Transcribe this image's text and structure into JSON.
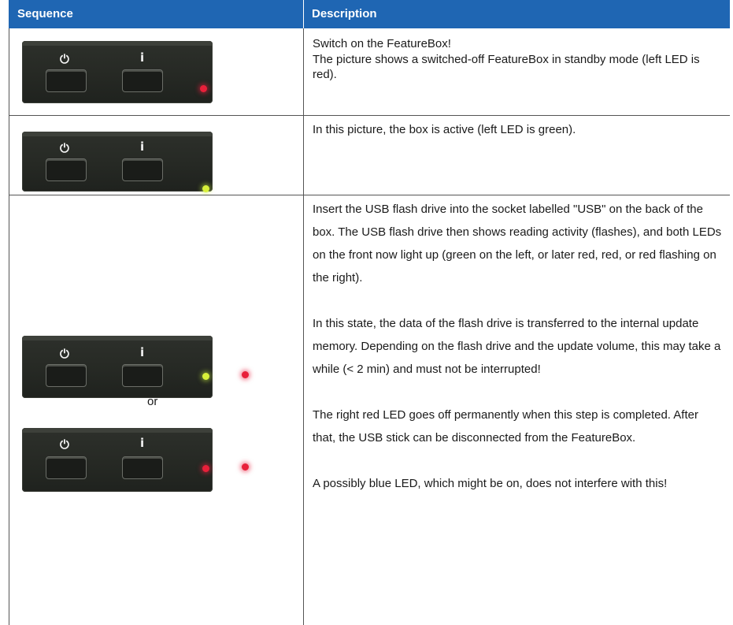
{
  "header": {
    "col1": "Sequence",
    "col2": "Description"
  },
  "rows": [
    {
      "text": [
        "Switch on the FeatureBox!",
        "The picture shows a switched-off FeatureBox in standby mode (left LED is red)."
      ],
      "leds": "left red"
    },
    {
      "text": [
        "In this picture, the box is active (left LED is green)."
      ],
      "leds": "left green"
    },
    {
      "text": [
        "Insert the USB flash drive into the socket labelled \"USB\" on the back of the box. The USB flash drive then shows reading activity (flashes), and both LEDs on the front now light up (green on the left, or later red, red, or red flashing on the right).",
        "In this state, the data of the flash drive is transferred to the internal update memory. Depending on the flash drive and the update volume, this may take a while (< 2 min) and must not be interrupted!",
        "The right red LED goes off permanently when this step is completed. After that, the USB stick can be disconnected from the FeatureBox.",
        "A possibly blue LED, which might be on, does not interfere with this!"
      ],
      "or_label": "or"
    }
  ],
  "colors": {
    "header_bg": "#1f66b3",
    "led_red": "#e8203a",
    "led_green": "#d8f03a"
  },
  "icons": [
    "power-icon",
    "info-icon"
  ]
}
